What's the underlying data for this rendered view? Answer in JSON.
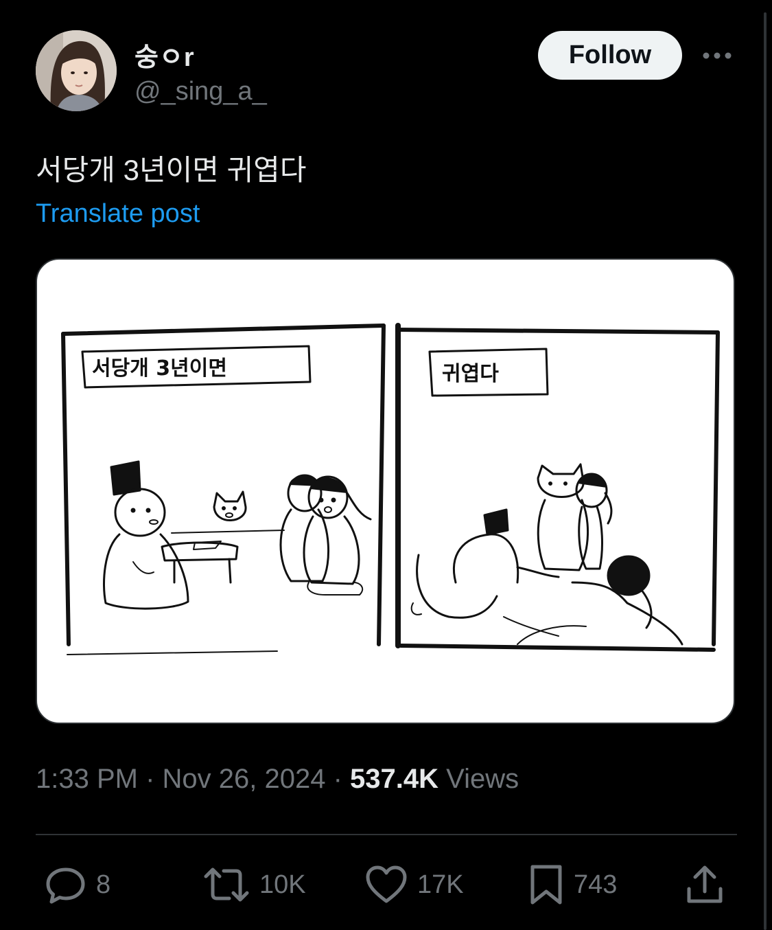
{
  "author": {
    "display_name": "숭ㅇr",
    "handle": "@_sing_a_"
  },
  "follow_label": "Follow",
  "post": {
    "text": "서당개 3년이면 귀엽다",
    "translate_label": "Translate post"
  },
  "comic": {
    "panel1_caption": "서당개 3년이면",
    "panel2_caption": "귀엽다"
  },
  "meta": {
    "time": "1:33 PM",
    "separator1": " · ",
    "date": "Nov 26, 2024",
    "separator2": " · ",
    "views_count": "537.4K",
    "views_label": " Views"
  },
  "actions": {
    "replies": "8",
    "reposts": "10K",
    "likes": "17K",
    "bookmarks": "743"
  },
  "colors": {
    "background": "#000000",
    "text_primary": "#e7e9ea",
    "text_secondary": "#71767b",
    "accent": "#1d9bf0",
    "divider": "#2f3336"
  },
  "icons": [
    "more-icon",
    "reply-icon",
    "repost-icon",
    "like-icon",
    "bookmark-icon",
    "share-icon"
  ]
}
